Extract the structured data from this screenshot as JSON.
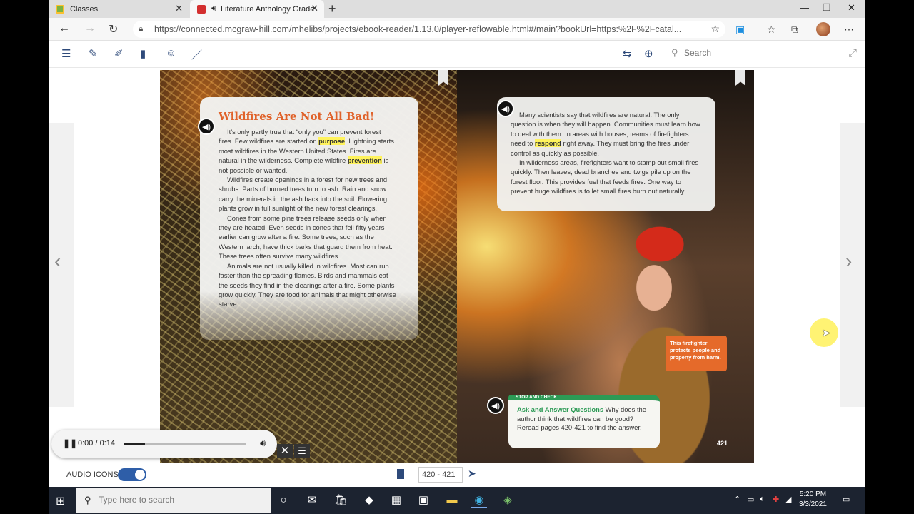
{
  "browser": {
    "tabs": [
      {
        "title": "Classes",
        "active": false
      },
      {
        "title": "Literature Anthology Grade",
        "active": true
      }
    ],
    "url": "https://connected.mcgraw-hill.com/mhelibs/projects/ebook-reader/1.13.0/player-reflowable.html#/main?bookUrl=https:%2F%2Fcatal..."
  },
  "reader": {
    "search_placeholder": "Search"
  },
  "left_page": {
    "title": "Wildfires Are Not All Bad!",
    "p1_a": "It’s only partly true that “only you” can prevent forest fires. Few wildfires are started on ",
    "p1_hl1": "purpose",
    "p1_b": ". Lightning starts most wildfires in the Western United States. Fires are natural in the wilderness. Complete wildfire ",
    "p1_hl2": "prevention",
    "p1_c": " is not possible or wanted.",
    "p2": "Wildfires create openings in a forest for new trees and shrubs. Parts of burned trees turn to ash. Rain and snow carry the minerals in the ash back into the soil. Flowering plants grow in full sunlight of the new forest clearings.",
    "p3": "Cones from some pine trees release seeds only when they are heated. Even seeds in cones that fell fifty years earlier can grow after a fire. Some trees, such as the Western larch, have thick barks that guard them from heat. These trees often survive many wildfires.",
    "p4": "Animals are not usually killed in wildfires. Most can run faster than the spreading flames. Birds and mammals eat the seeds they find in the clearings after a fire. Some plants grow quickly. They are food for animals that might otherwise starve."
  },
  "right_page": {
    "p1_a": "Many scientists say that wildfires are natural. The only question is when they will happen. Communities must learn how to deal with them. In areas with houses, teams of firefighters need to ",
    "p1_hl": "respond",
    "p1_b": " right away. They must bring the fires under control as quickly as possible.",
    "p2": "In wilderness areas, firefighters want to stamp out small fires quickly. Then leaves, dead branches and twigs pile up on the forest floor. This provides fuel that feeds fires. One way to prevent huge wildfires is to let small fires burn out naturally.",
    "caption": "This firefighter protects people and property from harm.",
    "stop_label": "STOP AND CHECK",
    "stop_heading": "Ask and Answer Questions",
    "stop_text": " Why does the author think that wildfires can be good? Reread pages 420-421 to find the answer.",
    "page_number": "421"
  },
  "player": {
    "time": "0:00 / 0:14",
    "progress": 0.17
  },
  "bottom": {
    "audio_icons_label": "AUDIO ICONS:",
    "audio_icons_on": true,
    "page_range": "420 - 421"
  },
  "taskbar": {
    "search_placeholder": "Type here to search",
    "time": "5:20 PM",
    "date": "3/3/2021"
  }
}
